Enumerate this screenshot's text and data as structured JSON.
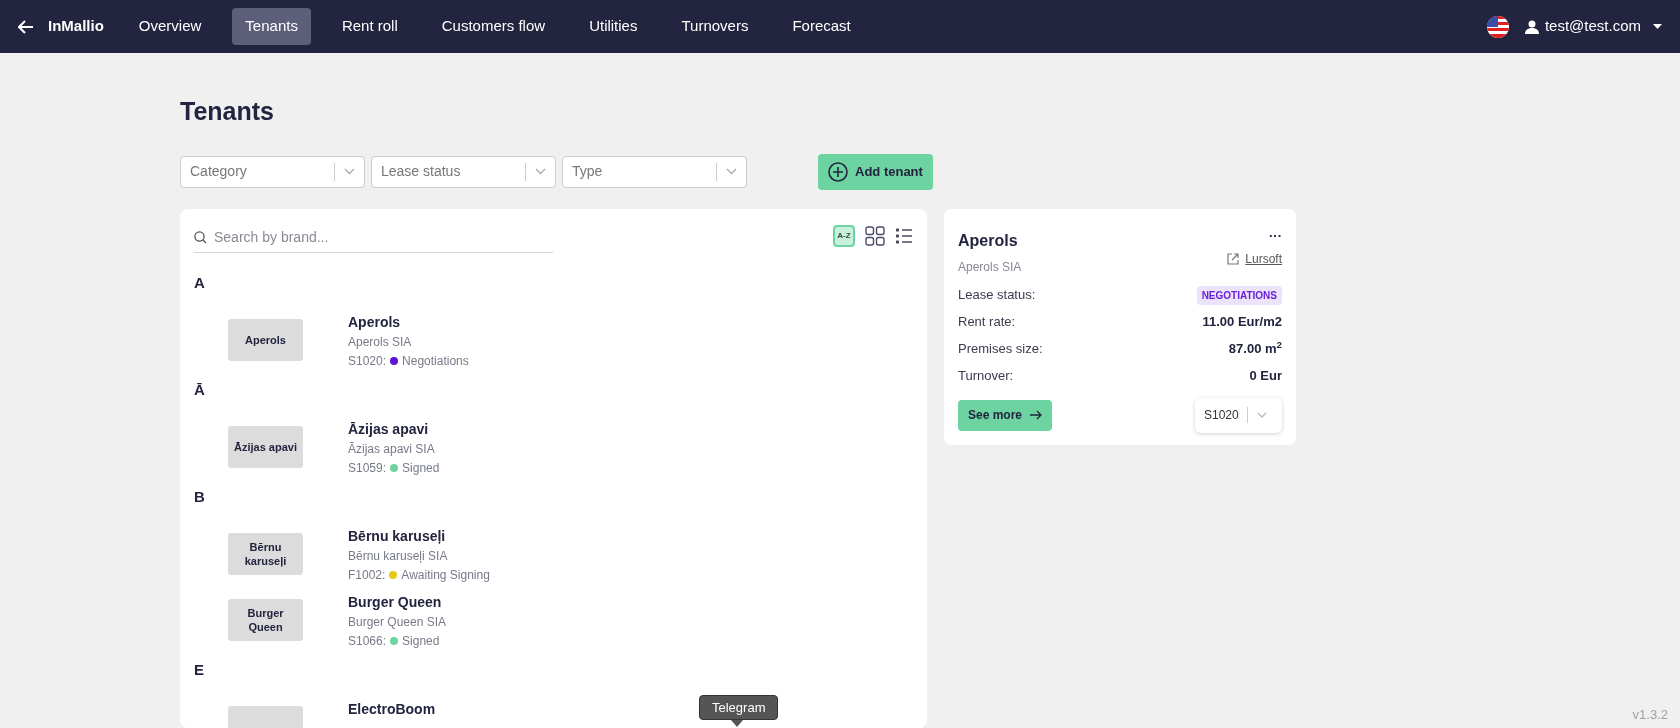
{
  "nav": {
    "brand": "InMallio",
    "tabs": [
      {
        "label": "Overview",
        "selected": false
      },
      {
        "label": "Tenants",
        "selected": true
      },
      {
        "label": "Rent roll",
        "selected": false
      },
      {
        "label": "Customers flow",
        "selected": false
      },
      {
        "label": "Utilities",
        "selected": false
      },
      {
        "label": "Turnovers",
        "selected": false
      },
      {
        "label": "Forecast",
        "selected": false
      }
    ],
    "user": "test@test.com"
  },
  "title": "Tenants",
  "filters": [
    {
      "placeholder": "Category"
    },
    {
      "placeholder": "Lease status"
    },
    {
      "placeholder": "Type"
    }
  ],
  "add_button": "Add tenant",
  "list": {
    "search_placeholder": "Search by brand...",
    "view_modes": [
      {
        "kind": "az",
        "label": "A-Z",
        "selected": true
      },
      {
        "kind": "grid",
        "selected": false
      },
      {
        "kind": "list",
        "selected": false
      }
    ],
    "groups": [
      {
        "letter": "A",
        "tenants": [
          {
            "logo": "Aperols",
            "name": "Aperols",
            "company": "Aperols SIA",
            "unit": "S1020:",
            "status": "Negotiations",
            "color": "#5b12d8"
          }
        ]
      },
      {
        "letter": "Ā",
        "tenants": [
          {
            "logo": "Āzijas apavi",
            "name": "Āzijas apavi",
            "company": "Āzijas apavi SIA",
            "unit": "S1059:",
            "status": "Signed",
            "color": "#6dd3a0"
          }
        ]
      },
      {
        "letter": "B",
        "tenants": [
          {
            "logo": "Bērnu karuseļi",
            "name": "Bērnu karuseļi",
            "company": "Bērnu karuseļi SIA",
            "unit": "F1002:",
            "status": "Awaiting Signing",
            "color": "#e8c817"
          },
          {
            "logo": "Burger Queen",
            "name": "Burger Queen",
            "company": "Burger Queen SIA",
            "unit": "S1066:",
            "status": "Signed",
            "color": "#6dd3a0"
          }
        ]
      },
      {
        "letter": "E",
        "tenants": [
          {
            "name": "ElectroBoom"
          }
        ]
      }
    ]
  },
  "detail": {
    "name": "Aperols",
    "company": "Aperols SIA",
    "menu": "···",
    "link": "Lursoft",
    "rows": [
      {
        "label": "Lease status:",
        "value": "NEGOTIATIONS",
        "kind": "badge"
      },
      {
        "label": "Rent rate:",
        "value": "11.00 Eur/m2",
        "kind": "text"
      },
      {
        "label": "Premises size:",
        "value": "87.00 m$^{2}$",
        "kind": "text"
      },
      {
        "label": "Turnover:",
        "value": "0 Eur",
        "kind": "text"
      }
    ],
    "see_more": "See more",
    "unit": "S1020"
  },
  "tooltip": "Telegram",
  "version": "v1.3.2"
}
